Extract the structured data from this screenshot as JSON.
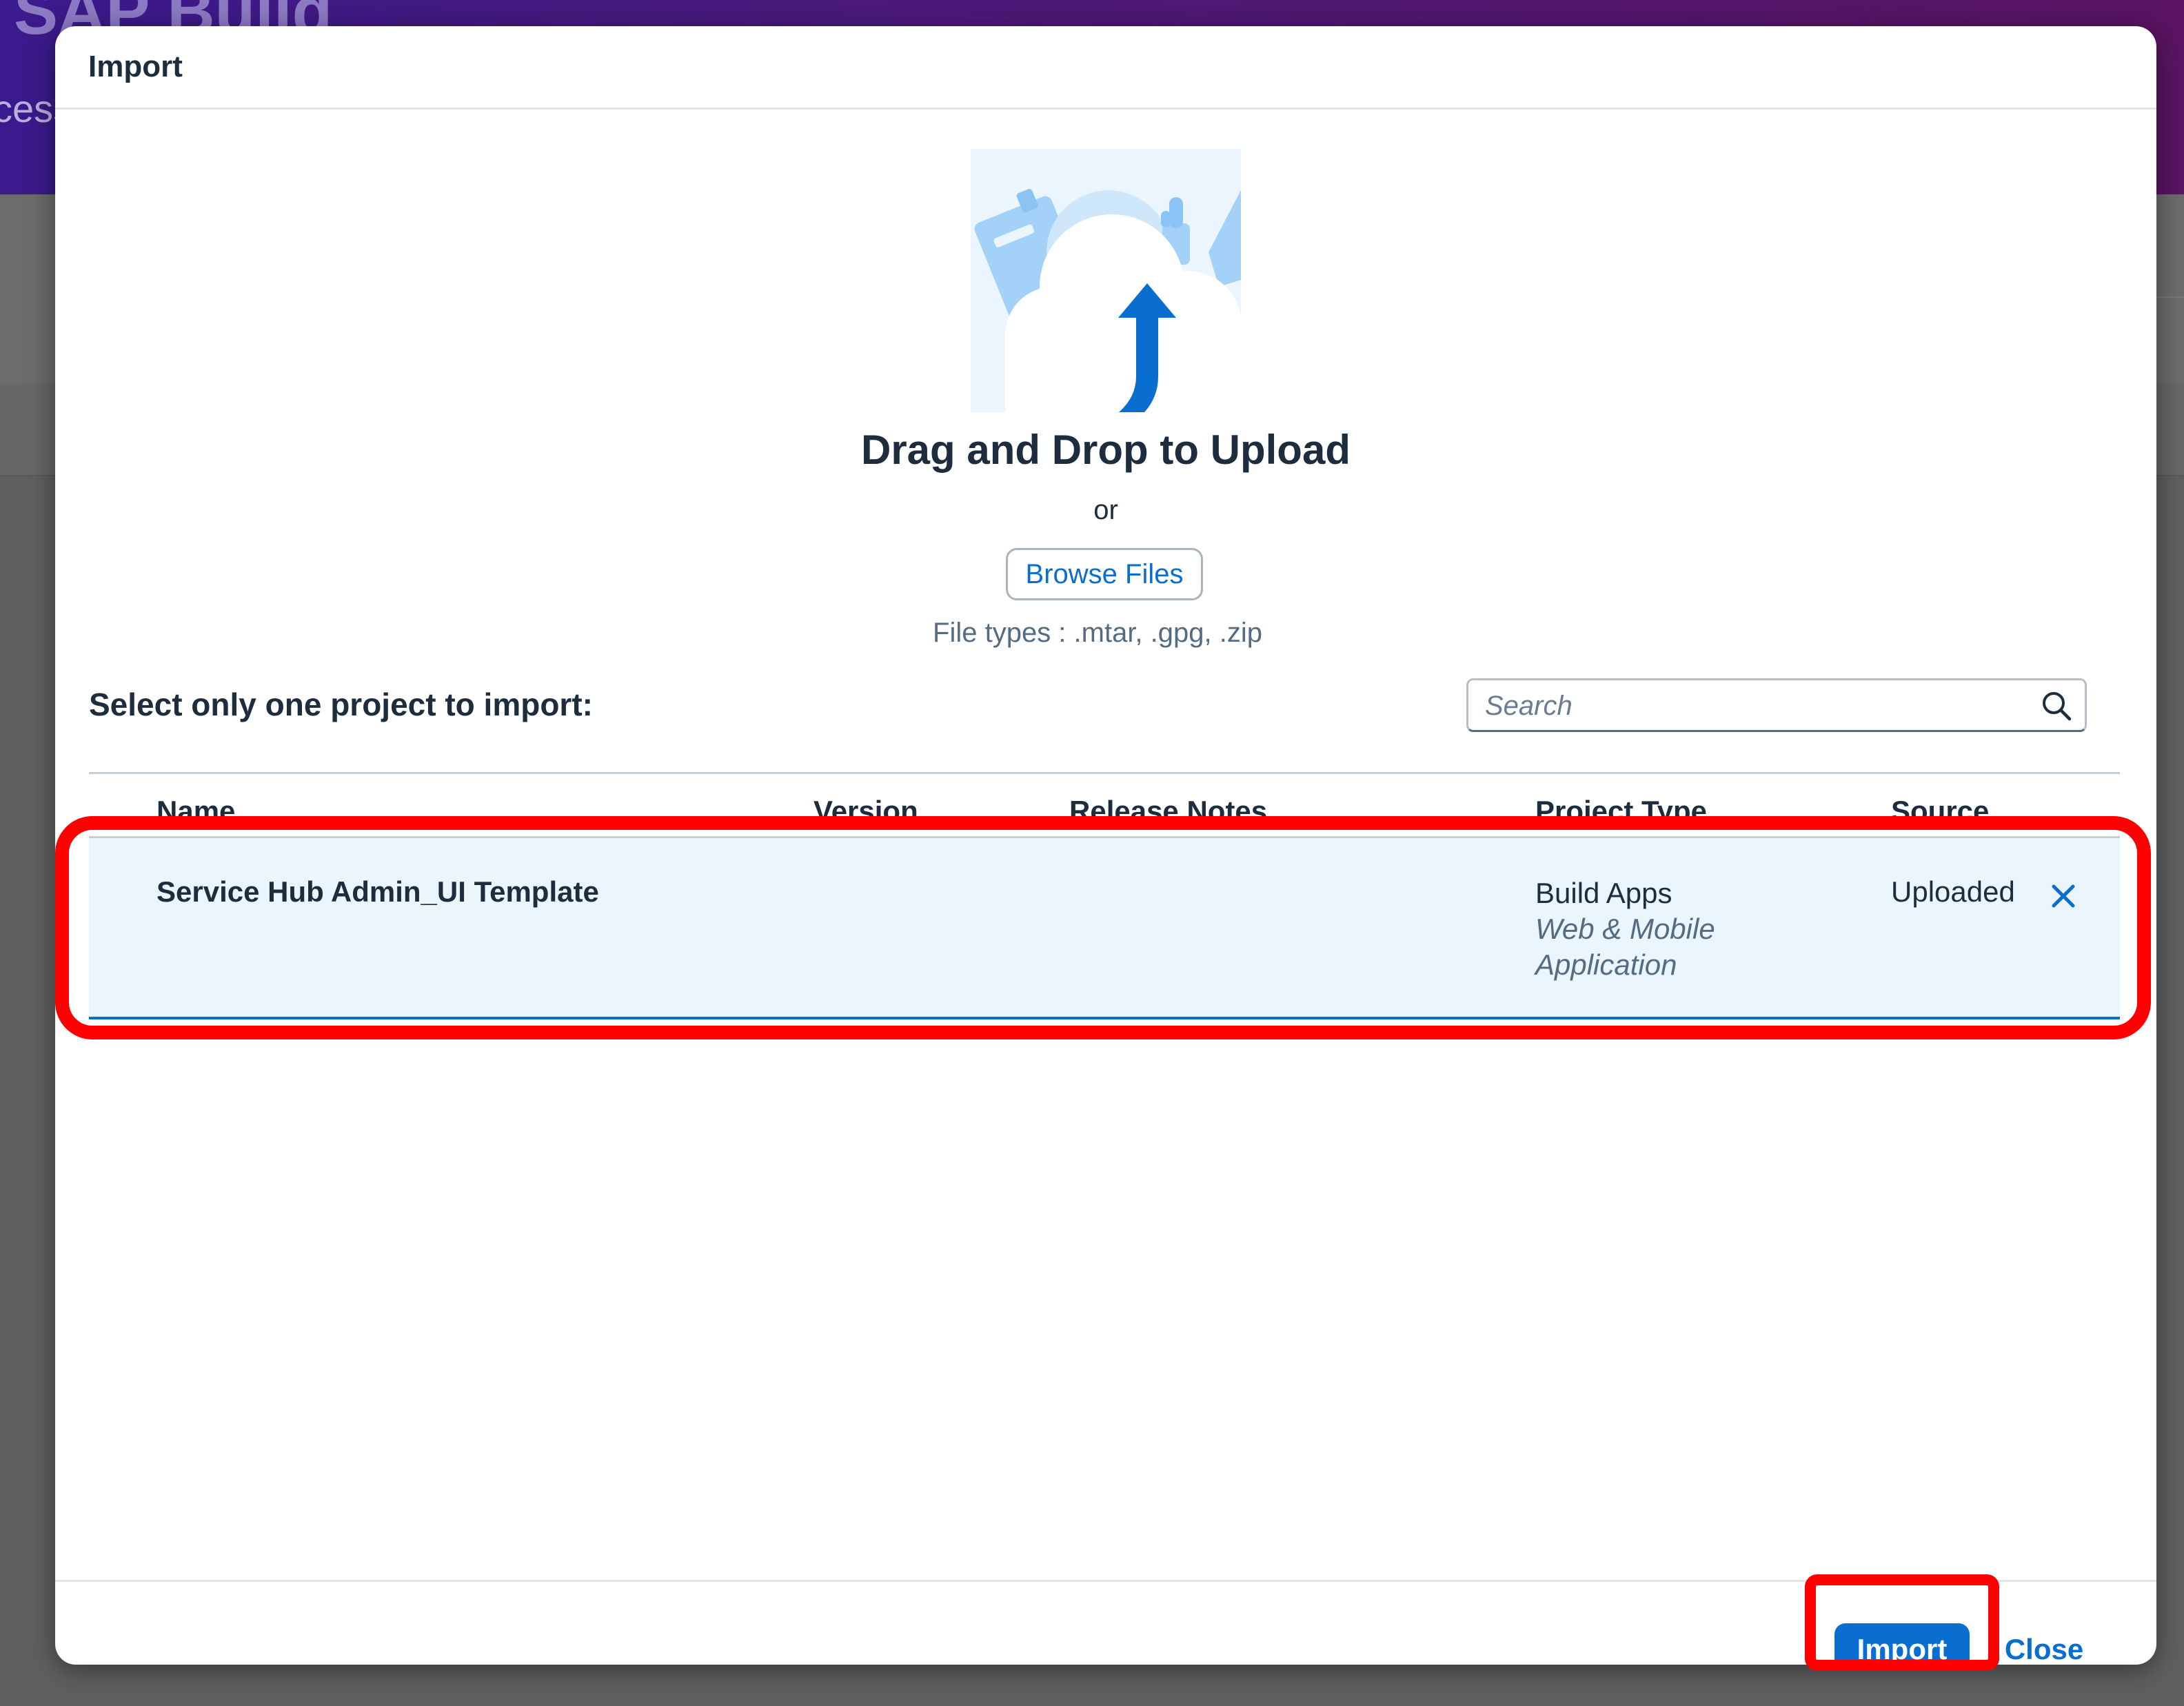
{
  "background": {
    "app_title": "SAP Build",
    "app_subtitle_fragment": "cess"
  },
  "dialog": {
    "title": "Import",
    "upload": {
      "heading": "Drag and Drop to Upload",
      "or": "or",
      "browse_label": "Browse Files",
      "file_types": "File types : .mtar, .gpg, .zip"
    },
    "select_label": "Select only one project to import:",
    "search": {
      "placeholder": "Search",
      "value": ""
    },
    "table": {
      "columns": [
        "Name",
        "Version",
        "Release Notes",
        "Project Type",
        "Source"
      ],
      "rows": [
        {
          "name": "Service Hub Admin_UI Template",
          "version": "",
          "release_notes": "",
          "project_type": "Build Apps",
          "project_subtype_line1": "Web & Mobile",
          "project_subtype_line2": "Application",
          "source": "Uploaded",
          "selected": true
        }
      ]
    },
    "footer": {
      "import_label": "Import",
      "close_label": "Close"
    }
  },
  "icons": {
    "upload": "cloud-upload-illustration",
    "search": "search-icon",
    "remove": "close-icon"
  },
  "colors": {
    "accent": "#0a6ed1",
    "selected_row": "#eaf5fd",
    "highlight": "#ff0000",
    "header_gradient_start": "#3a1a8c",
    "header_gradient_end": "#5a1463"
  }
}
